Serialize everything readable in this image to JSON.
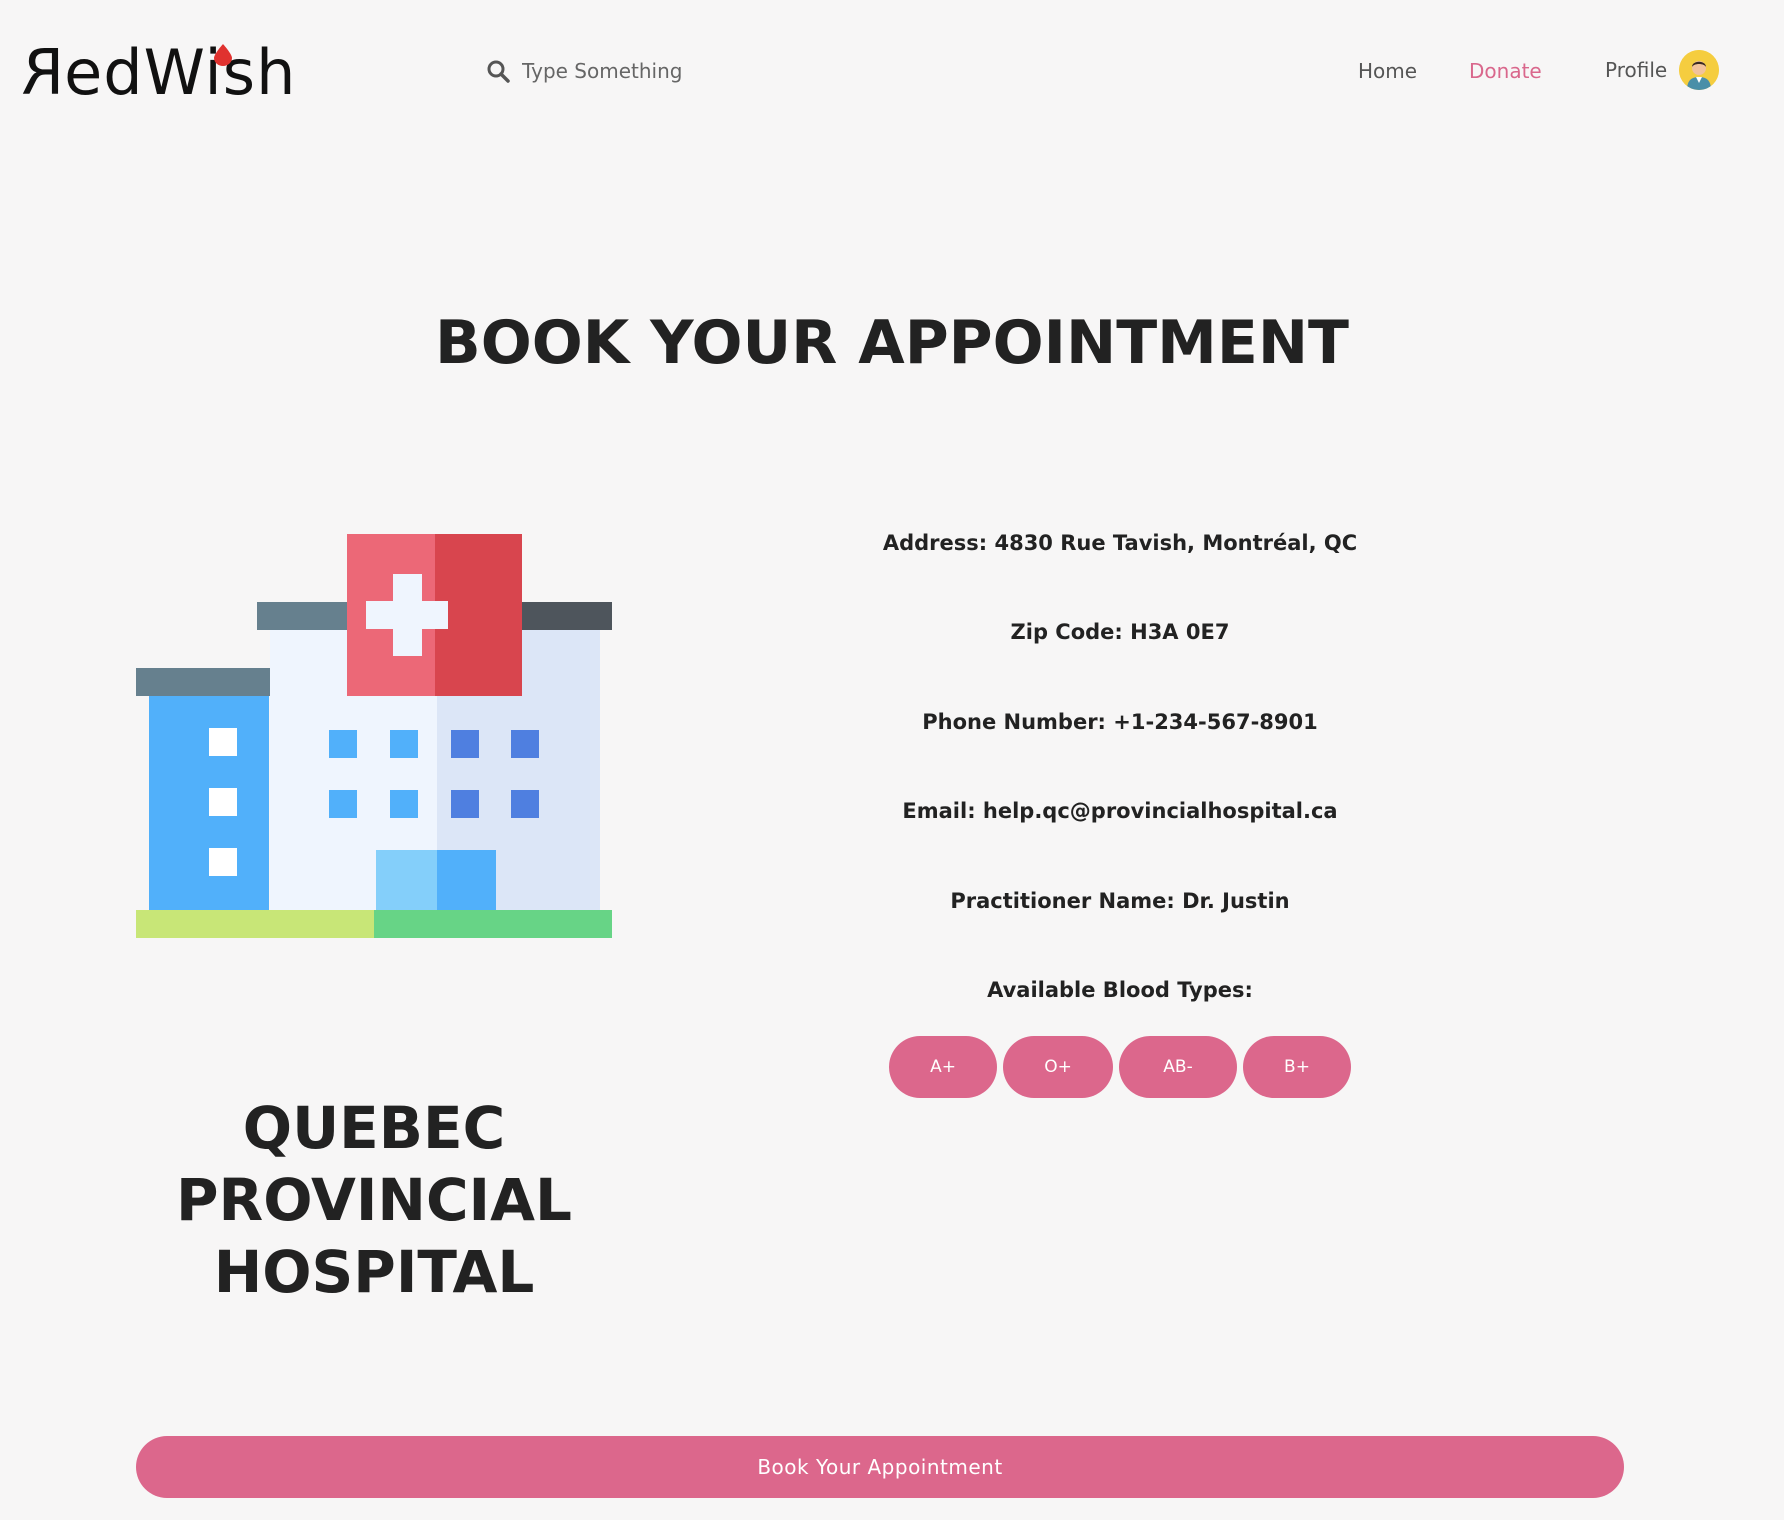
{
  "header": {
    "logo_text_prefix": "R",
    "logo_text_rest": "edW",
    "logo_text_end": "ish",
    "search_placeholder": "Type Something",
    "nav": {
      "home": "Home",
      "donate": "Donate",
      "profile": "Profile"
    }
  },
  "page": {
    "title": "BOOK YOUR APPOINTMENT"
  },
  "hospital": {
    "name_line1": "QUEBEC",
    "name_line2": "PROVINCIAL",
    "name_line3": "HOSPITAL"
  },
  "info": {
    "address": "Address: 4830 Rue Tavish, Montréal, QC",
    "zip": "Zip Code: H3A 0E7",
    "phone": "Phone Number: +1-234-567-8901",
    "email": "Email: help.qc@provincialhospital.ca",
    "practitioner": "Practitioner Name: Dr. Justin",
    "blood_types_label": "Available Blood Types:"
  },
  "blood_types": [
    "A+",
    "O+",
    "AB-",
    "B+"
  ],
  "actions": {
    "book_label": "Book Your Appointment"
  },
  "colors": {
    "accent": "#dc678c",
    "background": "#f7f6f6",
    "text": "#222222"
  },
  "icons": {
    "search": "search-icon",
    "avatar": "avatar-icon",
    "hospital": "hospital-building-icon",
    "logo_drop": "blood-drop-icon"
  }
}
